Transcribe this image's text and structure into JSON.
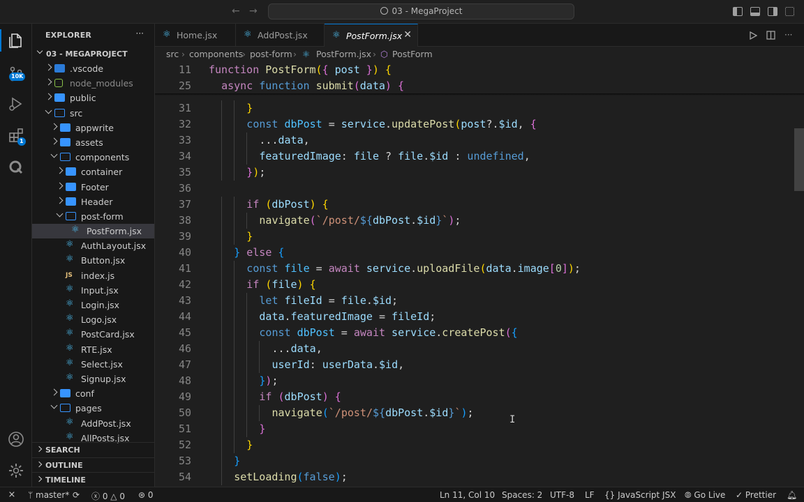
{
  "titlebar": {
    "search_text": "03 - MegaProject",
    "back_glyph": "←",
    "forward_glyph": "→"
  },
  "activity": {
    "source_control_badge": "10K",
    "extensions_badge": "1"
  },
  "sidebar": {
    "title": "EXPLORER",
    "more": "···",
    "project": "03 - MEGAPROJECT",
    "tree": [
      {
        "label": ".vscode",
        "depth": 1,
        "kind": "vscode",
        "chev": "right"
      },
      {
        "label": "node_modules",
        "depth": 1,
        "kind": "nm",
        "chev": "right",
        "dim": true
      },
      {
        "label": "public",
        "depth": 1,
        "kind": "folder",
        "chev": "right"
      },
      {
        "label": "src",
        "depth": 1,
        "kind": "folder-open",
        "chev": "down"
      },
      {
        "label": "appwrite",
        "depth": 2,
        "kind": "folder",
        "chev": "right"
      },
      {
        "label": "assets",
        "depth": 2,
        "kind": "folder",
        "chev": "right"
      },
      {
        "label": "components",
        "depth": 2,
        "kind": "folder-open",
        "chev": "down"
      },
      {
        "label": "container",
        "depth": 3,
        "kind": "folder",
        "chev": "right"
      },
      {
        "label": "Footer",
        "depth": 3,
        "kind": "folder",
        "chev": "right"
      },
      {
        "label": "Header",
        "depth": 3,
        "kind": "folder",
        "chev": "right"
      },
      {
        "label": "post-form",
        "depth": 3,
        "kind": "folder-open",
        "chev": "down"
      },
      {
        "label": "PostForm.jsx",
        "depth": 4,
        "kind": "react",
        "selected": true
      },
      {
        "label": "AuthLayout.jsx",
        "depth": 3,
        "kind": "react"
      },
      {
        "label": "Button.jsx",
        "depth": 3,
        "kind": "react"
      },
      {
        "label": "index.js",
        "depth": 3,
        "kind": "js"
      },
      {
        "label": "Input.jsx",
        "depth": 3,
        "kind": "react"
      },
      {
        "label": "Login.jsx",
        "depth": 3,
        "kind": "react"
      },
      {
        "label": "Logo.jsx",
        "depth": 3,
        "kind": "react"
      },
      {
        "label": "PostCard.jsx",
        "depth": 3,
        "kind": "react"
      },
      {
        "label": "RTE.jsx",
        "depth": 3,
        "kind": "react"
      },
      {
        "label": "Select.jsx",
        "depth": 3,
        "kind": "react"
      },
      {
        "label": "Signup.jsx",
        "depth": 3,
        "kind": "react"
      },
      {
        "label": "conf",
        "depth": 2,
        "kind": "folder",
        "chev": "right"
      },
      {
        "label": "pages",
        "depth": 2,
        "kind": "folder-open",
        "chev": "down"
      },
      {
        "label": "AddPost.jsx",
        "depth": 3,
        "kind": "react"
      },
      {
        "label": "AllPosts.jsx",
        "depth": 3,
        "kind": "react"
      }
    ],
    "sections": [
      "SEARCH",
      "OUTLINE",
      "TIMELINE"
    ]
  },
  "tabs": [
    {
      "label": "Home.jsx",
      "active": false
    },
    {
      "label": "AddPost.jsx",
      "active": false
    },
    {
      "label": "PostForm.jsx",
      "active": true
    }
  ],
  "tab_close": "✕",
  "breadcrumb": [
    "src",
    "components",
    "post-form",
    "PostForm.jsx",
    "PostForm"
  ],
  "breadcrumb_sep": "›",
  "editor": {
    "sticky": [
      {
        "n": "11",
        "indent": 0,
        "tokens": [
          [
            "kw",
            "function "
          ],
          [
            "fn",
            "PostForm"
          ],
          [
            "bk1",
            "("
          ],
          [
            "bk2",
            "{ "
          ],
          [
            "param",
            "post"
          ],
          [
            "bk2",
            " }"
          ],
          [
            "bk1",
            ")"
          ],
          [
            "plain",
            " "
          ],
          [
            "bk1",
            "{"
          ]
        ]
      },
      {
        "n": "25",
        "indent": 1,
        "tokens": [
          [
            "kw",
            "async "
          ],
          [
            "decl",
            "function "
          ],
          [
            "fn",
            "submit"
          ],
          [
            "bk2",
            "("
          ],
          [
            "param",
            "data"
          ],
          [
            "bk2",
            ")"
          ],
          [
            "plain",
            " "
          ],
          [
            "bk2",
            "{"
          ]
        ]
      }
    ],
    "lines": [
      {
        "n": "31",
        "indent": 3,
        "tokens": [
          [
            "bk1",
            "}"
          ]
        ]
      },
      {
        "n": "32",
        "indent": 3,
        "tokens": [
          [
            "decl",
            "const "
          ],
          [
            "cst",
            "dbPost"
          ],
          [
            "plain",
            " = "
          ],
          [
            "var",
            "service"
          ],
          [
            "plain",
            "."
          ],
          [
            "fn",
            "updatePost"
          ],
          [
            "bk1",
            "("
          ],
          [
            "var",
            "post"
          ],
          [
            "plain",
            "?."
          ],
          [
            "prop",
            "$id"
          ],
          [
            "plain",
            ", "
          ],
          [
            "bk2",
            "{"
          ]
        ]
      },
      {
        "n": "33",
        "indent": 4,
        "tokens": [
          [
            "plain",
            "..."
          ],
          [
            "var",
            "data"
          ],
          [
            "plain",
            ","
          ]
        ]
      },
      {
        "n": "34",
        "indent": 4,
        "tokens": [
          [
            "prop",
            "featuredImage"
          ],
          [
            "plain",
            ": "
          ],
          [
            "var",
            "file"
          ],
          [
            "plain",
            " ? "
          ],
          [
            "var",
            "file"
          ],
          [
            "plain",
            "."
          ],
          [
            "prop",
            "$id"
          ],
          [
            "plain",
            " : "
          ],
          [
            "decl",
            "undefined"
          ],
          [
            "plain",
            ","
          ]
        ]
      },
      {
        "n": "35",
        "indent": 3,
        "tokens": [
          [
            "bk2",
            "}"
          ],
          [
            "bk1",
            ")"
          ],
          [
            "plain",
            ";"
          ]
        ]
      },
      {
        "n": "36",
        "indent": 0,
        "tokens": []
      },
      {
        "n": "37",
        "indent": 3,
        "tokens": [
          [
            "kw",
            "if "
          ],
          [
            "bk1",
            "("
          ],
          [
            "var",
            "dbPost"
          ],
          [
            "bk1",
            ")"
          ],
          [
            "plain",
            " "
          ],
          [
            "bk1",
            "{"
          ]
        ]
      },
      {
        "n": "38",
        "indent": 4,
        "tokens": [
          [
            "fn",
            "navigate"
          ],
          [
            "bk2",
            "("
          ],
          [
            "str",
            "`/post/"
          ],
          [
            "decl",
            "${"
          ],
          [
            "var",
            "dbPost"
          ],
          [
            "plain",
            "."
          ],
          [
            "prop",
            "$id"
          ],
          [
            "decl",
            "}"
          ],
          [
            "str",
            "`"
          ],
          [
            "bk2",
            ")"
          ],
          [
            "plain",
            ";"
          ]
        ]
      },
      {
        "n": "39",
        "indent": 3,
        "tokens": [
          [
            "bk1",
            "}"
          ]
        ]
      },
      {
        "n": "40",
        "indent": 2,
        "tokens": [
          [
            "bk3",
            "}"
          ],
          [
            "plain",
            " "
          ],
          [
            "kw",
            "else "
          ],
          [
            "bk3",
            "{"
          ]
        ]
      },
      {
        "n": "41",
        "indent": 3,
        "tokens": [
          [
            "decl",
            "const "
          ],
          [
            "cst",
            "file"
          ],
          [
            "plain",
            " = "
          ],
          [
            "kw",
            "await "
          ],
          [
            "var",
            "service"
          ],
          [
            "plain",
            "."
          ],
          [
            "fn",
            "uploadFile"
          ],
          [
            "bk1",
            "("
          ],
          [
            "var",
            "data"
          ],
          [
            "plain",
            "."
          ],
          [
            "prop",
            "image"
          ],
          [
            "bk2",
            "["
          ],
          [
            "num",
            "0"
          ],
          [
            "bk2",
            "]"
          ],
          [
            "bk1",
            ")"
          ],
          [
            "plain",
            ";"
          ]
        ]
      },
      {
        "n": "42",
        "indent": 3,
        "tokens": [
          [
            "kw",
            "if "
          ],
          [
            "bk1",
            "("
          ],
          [
            "var",
            "file"
          ],
          [
            "bk1",
            ")"
          ],
          [
            "plain",
            " "
          ],
          [
            "bk1",
            "{"
          ]
        ]
      },
      {
        "n": "43",
        "indent": 4,
        "tokens": [
          [
            "decl",
            "let "
          ],
          [
            "var",
            "fileId"
          ],
          [
            "plain",
            " = "
          ],
          [
            "var",
            "file"
          ],
          [
            "plain",
            "."
          ],
          [
            "prop",
            "$id"
          ],
          [
            "plain",
            ";"
          ]
        ]
      },
      {
        "n": "44",
        "indent": 4,
        "tokens": [
          [
            "var",
            "data"
          ],
          [
            "plain",
            "."
          ],
          [
            "prop",
            "featuredImage"
          ],
          [
            "plain",
            " = "
          ],
          [
            "var",
            "fileId"
          ],
          [
            "plain",
            ";"
          ]
        ]
      },
      {
        "n": "45",
        "indent": 4,
        "tokens": [
          [
            "decl",
            "const "
          ],
          [
            "cst",
            "dbPost"
          ],
          [
            "plain",
            " = "
          ],
          [
            "kw",
            "await "
          ],
          [
            "var",
            "service"
          ],
          [
            "plain",
            "."
          ],
          [
            "fn",
            "createPost"
          ],
          [
            "bk2",
            "("
          ],
          [
            "bk3",
            "{"
          ]
        ]
      },
      {
        "n": "46",
        "indent": 5,
        "tokens": [
          [
            "plain",
            "..."
          ],
          [
            "var",
            "data"
          ],
          [
            "plain",
            ","
          ]
        ]
      },
      {
        "n": "47",
        "indent": 5,
        "tokens": [
          [
            "prop",
            "userId"
          ],
          [
            "plain",
            ": "
          ],
          [
            "var",
            "userData"
          ],
          [
            "plain",
            "."
          ],
          [
            "prop",
            "$id"
          ],
          [
            "plain",
            ","
          ]
        ]
      },
      {
        "n": "48",
        "indent": 4,
        "tokens": [
          [
            "bk3",
            "}"
          ],
          [
            "bk2",
            ")"
          ],
          [
            "plain",
            ";"
          ]
        ]
      },
      {
        "n": "49",
        "indent": 4,
        "tokens": [
          [
            "kw",
            "if "
          ],
          [
            "bk2",
            "("
          ],
          [
            "var",
            "dbPost"
          ],
          [
            "bk2",
            ")"
          ],
          [
            "plain",
            " "
          ],
          [
            "bk2",
            "{"
          ]
        ]
      },
      {
        "n": "50",
        "indent": 5,
        "tokens": [
          [
            "fn",
            "navigate"
          ],
          [
            "bk3",
            "("
          ],
          [
            "str",
            "`/post/"
          ],
          [
            "decl",
            "${"
          ],
          [
            "var",
            "dbPost"
          ],
          [
            "plain",
            "."
          ],
          [
            "prop",
            "$id"
          ],
          [
            "decl",
            "}"
          ],
          [
            "str",
            "`"
          ],
          [
            "bk3",
            ")"
          ],
          [
            "plain",
            ";"
          ]
        ]
      },
      {
        "n": "51",
        "indent": 4,
        "tokens": [
          [
            "bk2",
            "}"
          ]
        ]
      },
      {
        "n": "52",
        "indent": 3,
        "tokens": [
          [
            "bk1",
            "}"
          ]
        ]
      },
      {
        "n": "53",
        "indent": 2,
        "tokens": [
          [
            "bk3",
            "}"
          ]
        ]
      },
      {
        "n": "54",
        "indent": 2,
        "tokens": [
          [
            "fn",
            "setLoading"
          ],
          [
            "bk3",
            "("
          ],
          [
            "decl",
            "false"
          ],
          [
            "bk3",
            ")"
          ],
          [
            "plain",
            ";"
          ]
        ]
      }
    ]
  },
  "statusbar": {
    "remote": "⨯",
    "branch": "master*",
    "sync": "⟳",
    "errors": "0",
    "warnings": "0",
    "ports": "0",
    "position": "Ln 11, Col 10",
    "spaces": "Spaces: 2",
    "encoding": "UTF-8",
    "eol": "LF",
    "language": "JavaScript JSX",
    "golive": "Go Live",
    "prettier": "Prettier"
  },
  "colors": {
    "accent": "#0078d4",
    "react": "#4fc3f7",
    "folder": "#3794ff"
  }
}
